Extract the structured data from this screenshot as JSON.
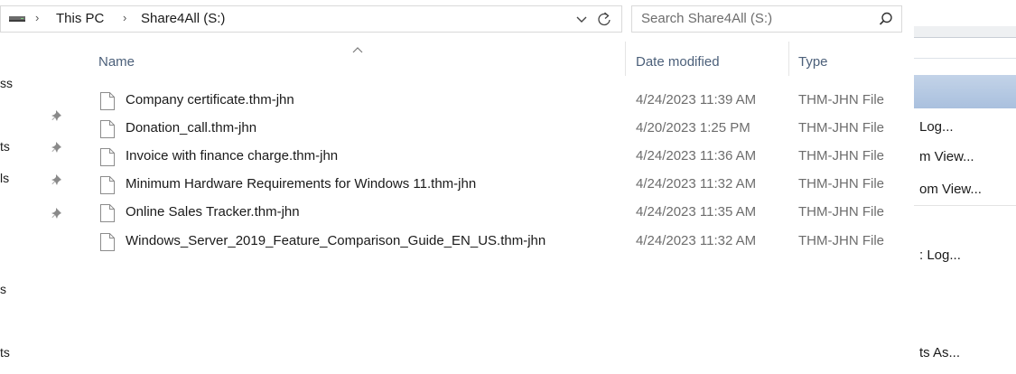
{
  "address_bar": {
    "crumbs": [
      "This PC",
      "Share4All (S:)"
    ],
    "separator": "›"
  },
  "search": {
    "placeholder": "Search Share4All (S:)"
  },
  "nav_fragments": [
    "ss",
    "ts",
    "ls",
    "s",
    "ts"
  ],
  "columns": {
    "name": "Name",
    "date_modified": "Date modified",
    "type": "Type"
  },
  "files": [
    {
      "name": "Company certificate.thm-jhn",
      "date": "4/24/2023 11:39 AM",
      "type": "THM-JHN File"
    },
    {
      "name": "Donation_call.thm-jhn",
      "date": "4/20/2023 1:25 PM",
      "type": "THM-JHN File"
    },
    {
      "name": "Invoice with finance charge.thm-jhn",
      "date": "4/24/2023 11:36 AM",
      "type": "THM-JHN File"
    },
    {
      "name": "Minimum Hardware Requirements for Windows 11.thm-jhn",
      "date": "4/24/2023 11:32 AM",
      "type": "THM-JHN File"
    },
    {
      "name": "Online Sales Tracker.thm-jhn",
      "date": "4/24/2023 11:35 AM",
      "type": "THM-JHN File"
    },
    {
      "name": "Windows_Server_2019_Feature_Comparison_Guide_EN_US.thm-jhn",
      "date": "4/24/2023 11:32 AM",
      "type": "THM-JHN File"
    }
  ],
  "background_window": {
    "items": [
      "Log...",
      "m View...",
      "om View...",
      ": Log...",
      "ts As..."
    ]
  },
  "colors": {
    "header_text": "#4c607a",
    "secondary_text": "#6d6d6d",
    "selection": "#a9c0de"
  }
}
